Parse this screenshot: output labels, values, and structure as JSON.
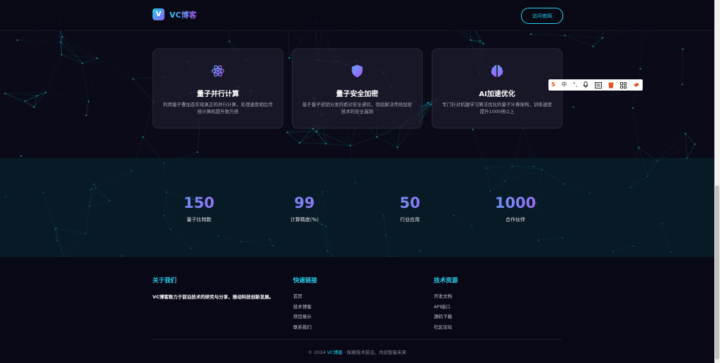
{
  "header": {
    "logo_badge": "V",
    "logo_text": "VC博客",
    "visit_button": "访问官网"
  },
  "features": [
    {
      "icon": "atom-icon",
      "title": "量子并行计算",
      "desc": "利用量子叠加态实现真正的并行计算，处理速度相比传统计算机提升数万倍"
    },
    {
      "icon": "shield-icon",
      "title": "量子安全加密",
      "desc": "基于量子密钥分发的绝对安全通信，彻底解决传统加密技术的安全漏洞"
    },
    {
      "icon": "brain-icon",
      "title": "AI加速优化",
      "desc": "专门针对机器学习算法优化的量子计算架构，训练速度提升1000倍以上"
    }
  ],
  "stats": [
    {
      "value": "150",
      "label": "量子比特数"
    },
    {
      "value": "99",
      "label": "计算精度(%)"
    },
    {
      "value": "50",
      "label": "行业应用"
    },
    {
      "value": "1000",
      "label": "合作伙伴"
    }
  ],
  "footer": {
    "about": {
      "title": "关于我们",
      "text": "VC博客致力于前沿技术的研究与分享，推动科技创新发展。"
    },
    "quick_links": {
      "title": "快速链接",
      "items": [
        "首页",
        "技术博客",
        "项目展示",
        "联系我们"
      ]
    },
    "resources": {
      "title": "技术资源",
      "items": [
        "开发文档",
        "API接口",
        "源码下载",
        "社区论坛"
      ]
    },
    "copyright_prefix": "© 2024 ",
    "copyright_brand": "VC博客",
    "copyright_suffix": " · 探索技术前沿，共创智能未来"
  },
  "ime_toolbar": [
    "S",
    "中",
    "°,",
    "mic-icon",
    "keyboard-icon",
    "skin-icon",
    "grid-icon",
    "tool-icon"
  ],
  "colors": {
    "accent": "#22d3ee",
    "purple": "#8b5cf6",
    "background": "#0b0a18"
  }
}
